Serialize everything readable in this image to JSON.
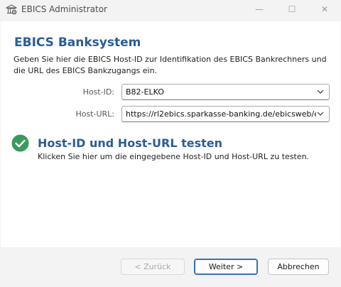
{
  "window": {
    "title": "EBICS Administrator",
    "minimize_glyph": "—",
    "maximize_glyph": "☐",
    "close_glyph": "✕"
  },
  "section": {
    "title": "EBICS Banksystem",
    "description": "Geben Sie hier die EBICS Host-ID zur Identifikation des EBICS Bankrechners und die URL des EBICS Bankzugangs ein."
  },
  "form": {
    "host_id_label": "Host-ID:",
    "host_id_value": "B82-ELKO",
    "host_url_label": "Host-URL:",
    "host_url_value": "https://rl2ebics.sparkasse-banking.de/ebicsweb/eb"
  },
  "test": {
    "title": "Host-ID und Host-URL testen",
    "description": "Klicken Sie hier um die eingegebene Host-ID und Host-URL zu testen.",
    "status_icon": "check-circle-icon",
    "status_color": "#3a9a5b"
  },
  "buttons": {
    "back_label": "< Zurück",
    "next_label": "Weiter >",
    "cancel_label": "Abbrechen"
  },
  "colors": {
    "heading": "#2b5d95",
    "default_button_border": "#3a6fb0"
  }
}
